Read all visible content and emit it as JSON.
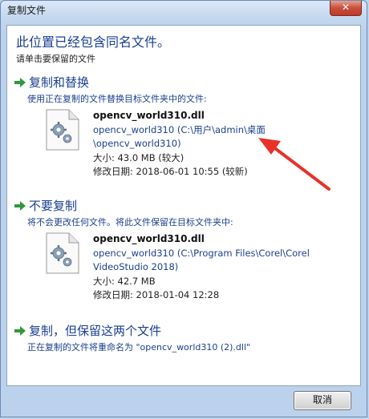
{
  "window": {
    "title": "复制文件",
    "close_label": "✕"
  },
  "header": {
    "title": "此位置已经包含同名文件。",
    "subtitle": "请单击要保留的文件"
  },
  "options": [
    {
      "title": "复制和替换",
      "description": "使用正在复制的文件替换目标文件夹中的文件:",
      "file": {
        "name": "opencv_world310.dll",
        "path_line1": "opencv_world310 (C:\\用户\\admin\\桌面",
        "path_line2": "\\opencv_world310)",
        "size": "大小: 43.0 MB (较大)",
        "modified": "修改日期: 2018-06-01 10:55 (较新)"
      }
    },
    {
      "title": "不要复制",
      "description": "将不会更改任何文件。将此文件保留在目标文件夹中:",
      "file": {
        "name": "opencv_world310.dll",
        "path_line1": "opencv_world310 (C:\\Program Files\\Corel\\Corel",
        "path_line2": "VideoStudio 2018)",
        "size": "大小: 42.7 MB",
        "modified": "修改日期: 2018-01-04 12:28"
      }
    },
    {
      "title": "复制，但保留这两个文件",
      "description": "正在复制的文件将重命名为 \"opencv_world310 (2).dll\""
    }
  ],
  "footer": {
    "cancel_label": "取消"
  },
  "colors": {
    "link_blue": "#1b3f8f",
    "arrow_green": "#2f9a3a",
    "annotation_red": "#e8312a"
  },
  "icons": {
    "option_arrow": "green-arrow-icon",
    "file": "dll-file-gear-icon",
    "close": "close-icon"
  }
}
